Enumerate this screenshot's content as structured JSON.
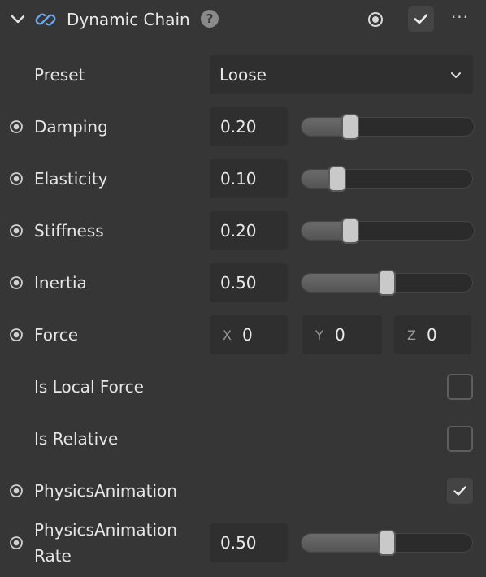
{
  "header": {
    "title": "Dynamic Chain",
    "help_glyph": "?",
    "more_glyph": "···",
    "enabled": true,
    "icons": [
      "chevron-down-icon",
      "link-icon",
      "help-icon",
      "keyframe-target-icon",
      "checkmark-icon",
      "more-icon"
    ]
  },
  "preset": {
    "label": "Preset",
    "value": "Loose"
  },
  "sliders": {
    "damping": {
      "label": "Damping",
      "value": "0.20",
      "fraction": 0.2
    },
    "elasticity": {
      "label": "Elasticity",
      "value": "0.10",
      "fraction": 0.1
    },
    "stiffness": {
      "label": "Stiffness",
      "value": "0.20",
      "fraction": 0.2
    },
    "inertia": {
      "label": "Inertia",
      "value": "0.50",
      "fraction": 0.5
    },
    "physics_rate": {
      "label_line1": "PhysicsAnimation",
      "label_line2": "Rate",
      "value": "0.50",
      "fraction": 0.5
    }
  },
  "force": {
    "label": "Force",
    "x_axis": "X",
    "x": "0",
    "y_axis": "Y",
    "y": "0",
    "z_axis": "Z",
    "z": "0"
  },
  "is_local_force": {
    "label": "Is Local Force",
    "checked": false
  },
  "is_relative": {
    "label": "Is Relative",
    "checked": false
  },
  "physics_animation": {
    "label": "PhysicsAnimation",
    "checked": true
  },
  "colors": {
    "background": "#363636",
    "field": "#2f2f2f",
    "accent_link": "#6fa3e6",
    "text": "#e6e6e6"
  }
}
